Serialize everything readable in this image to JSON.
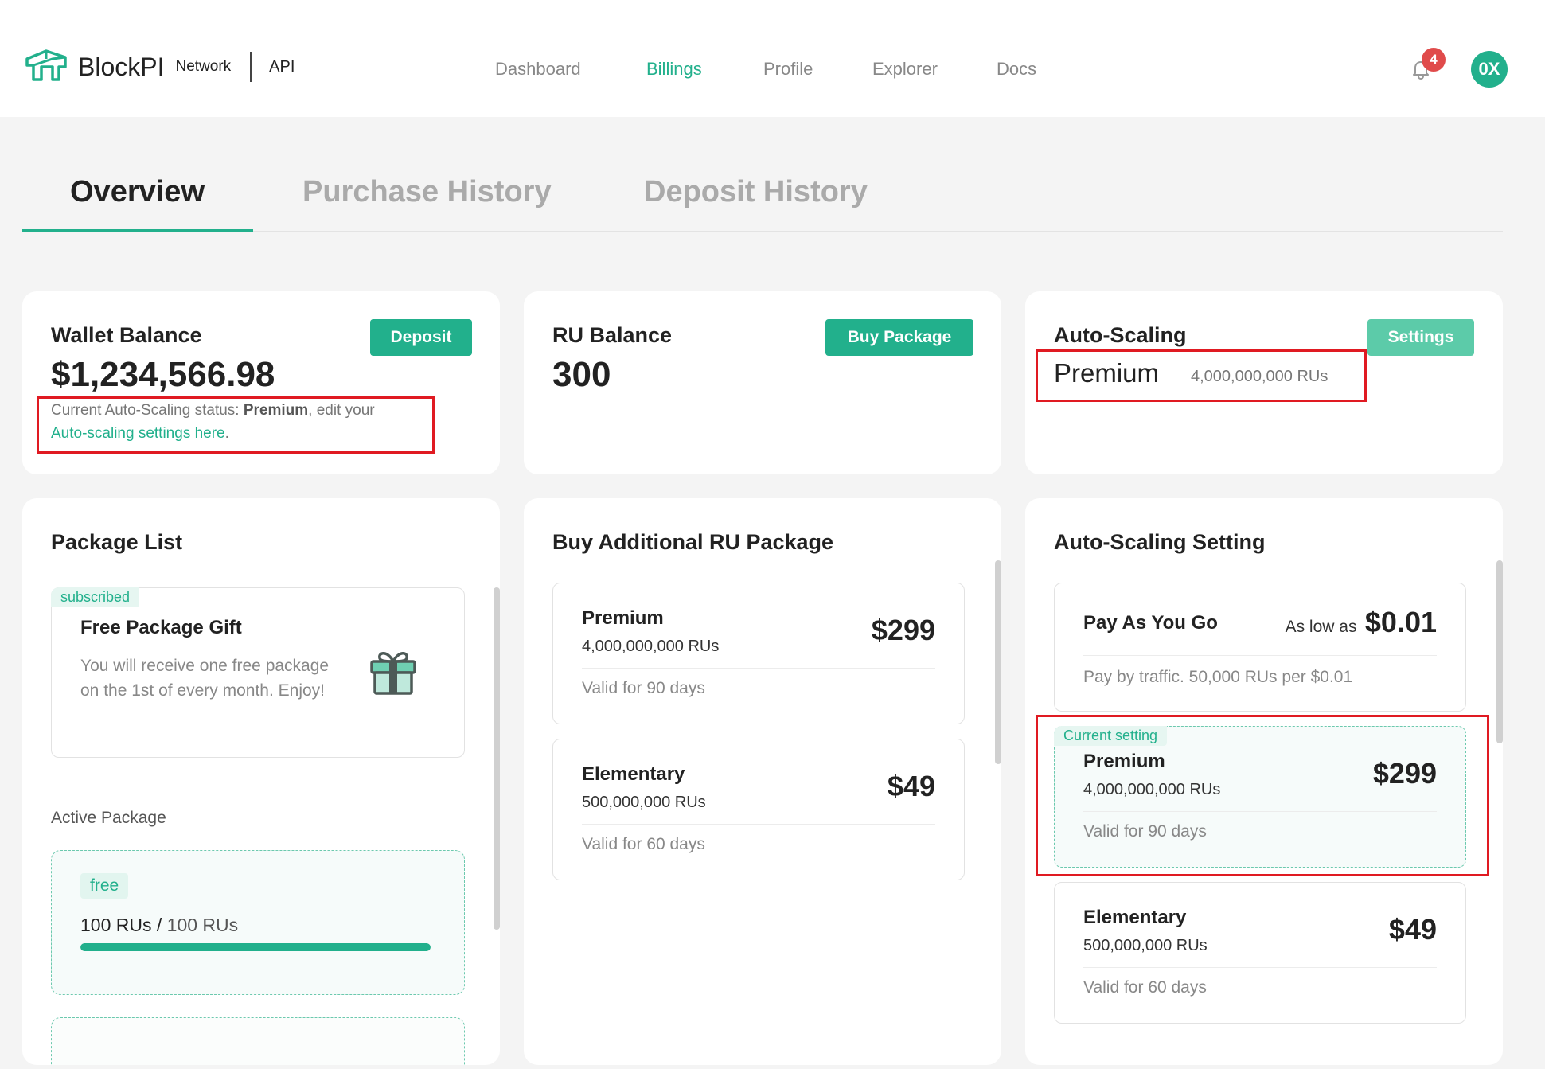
{
  "header": {
    "brand": "BlockPI",
    "brand_sub": "Network",
    "product": "API",
    "nav": [
      {
        "label": "Dashboard",
        "active": false
      },
      {
        "label": "Billings",
        "active": true
      },
      {
        "label": "Profile",
        "active": false
      },
      {
        "label": "Explorer",
        "active": false
      },
      {
        "label": "Docs",
        "active": false
      }
    ],
    "notification_count": "4",
    "avatar_initials": "0X"
  },
  "tabs": [
    {
      "label": "Overview",
      "active": true
    },
    {
      "label": "Purchase History",
      "active": false
    },
    {
      "label": "Deposit History",
      "active": false
    }
  ],
  "wallet": {
    "title": "Wallet Balance",
    "button": "Deposit",
    "balance": "$1,234,566.98",
    "status_prefix": "Current Auto-Scaling status: ",
    "status_value": "Premium",
    "status_suffix": ", edit your",
    "status_link": "Auto-scaling settings here",
    "status_end": "."
  },
  "ru_balance": {
    "title": "RU Balance",
    "button": "Buy Package",
    "value": "300"
  },
  "auto_scaling": {
    "title": "Auto-Scaling",
    "button": "Settings",
    "plan": "Premium",
    "plan_ru": "4,000,000,000 RUs"
  },
  "package_list": {
    "title": "Package List",
    "gift_tag": "subscribed",
    "gift_title": "Free Package Gift",
    "gift_desc": "You will receive one free package on the 1st of every month. Enjoy!",
    "active_label": "Active Package",
    "active_tag": "free",
    "active_used": "100 RUs",
    "active_sep": " / ",
    "active_total": "100 RUs",
    "active_progress": 1.0
  },
  "buy_packages": {
    "title": "Buy Additional RU Package",
    "items": [
      {
        "name": "Premium",
        "ru": "4,000,000,000 RUs",
        "price": "$299",
        "valid": "Valid for 90 days"
      },
      {
        "name": "Elementary",
        "ru": "500,000,000 RUs",
        "price": "$49",
        "valid": "Valid for 60 days"
      }
    ]
  },
  "auto_scaling_setting": {
    "title": "Auto-Scaling Setting",
    "payg": {
      "name": "Pay As You Go",
      "as_low_as": "As low as",
      "price": "$0.01",
      "desc": "Pay by traffic. 50,000 RUs per $0.01"
    },
    "current_tag": "Current setting",
    "items": [
      {
        "name": "Premium",
        "ru": "4,000,000,000 RUs",
        "price": "$299",
        "valid": "Valid for 90 days"
      },
      {
        "name": "Elementary",
        "ru": "500,000,000 RUs",
        "price": "$49",
        "valid": "Valid for 60 days"
      }
    ]
  },
  "colors": {
    "accent": "#22b08c",
    "highlight_border": "#e01a22",
    "badge": "#e04b4b"
  }
}
